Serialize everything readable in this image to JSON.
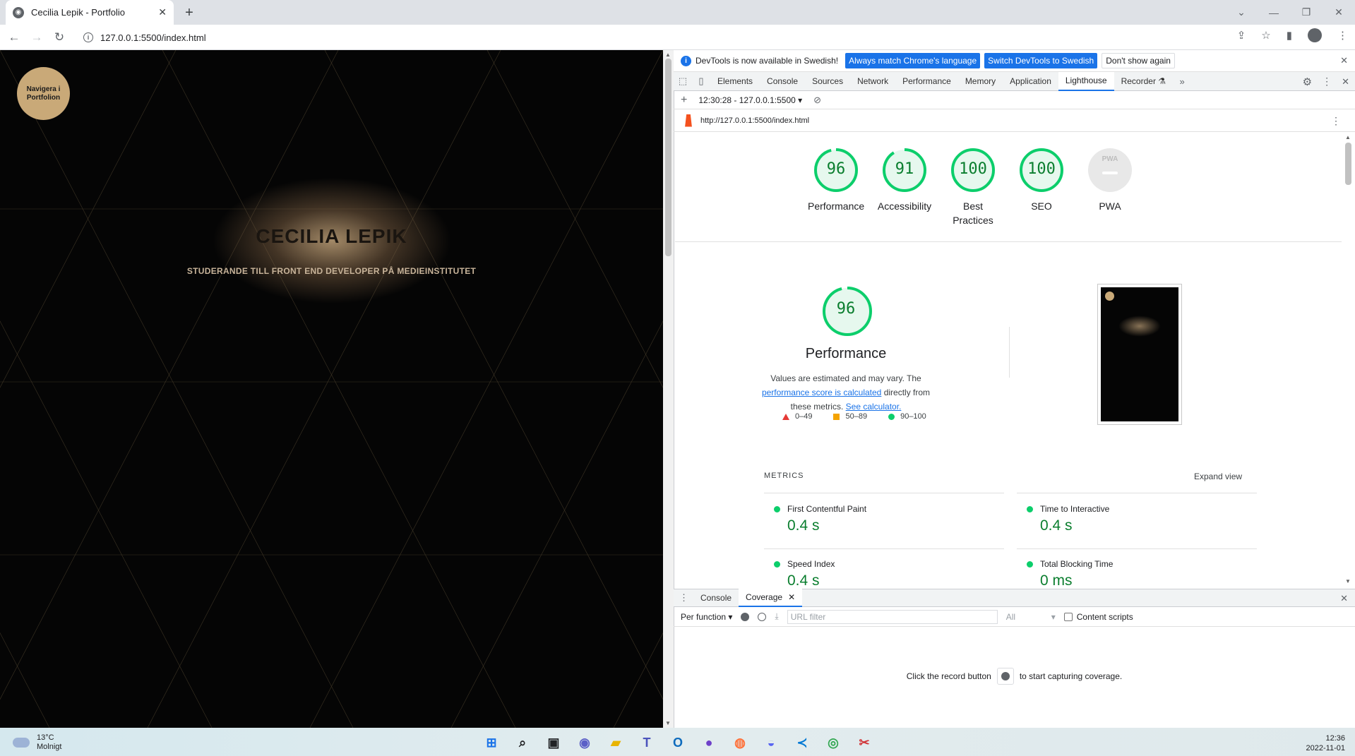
{
  "browser": {
    "tab_title": "Cecilia Lepik - Portfolio",
    "url": "127.0.0.1:5500/index.html"
  },
  "page": {
    "nav_button": "Navigera i Portfolion",
    "hero_title": "CECILIA LEPIK",
    "hero_subtitle": "STUDERANDE TILL FRONT END DEVELOPER PÅ MEDIEINSTITUTET"
  },
  "devtools": {
    "infobar": {
      "message": "DevTools is now available in Swedish!",
      "btn_match": "Always match Chrome's language",
      "btn_switch": "Switch DevTools to Swedish",
      "btn_dont": "Don't show again"
    },
    "tabs": [
      "Elements",
      "Console",
      "Sources",
      "Network",
      "Performance",
      "Memory",
      "Application",
      "Lighthouse",
      "Recorder"
    ],
    "active_tab": "Lighthouse",
    "lighthouse_report_select": "12:30:28 - 127.0.0.1:5500",
    "report_url": "http://127.0.0.1:5500/index.html",
    "scores": [
      {
        "label": "Performance",
        "value": "96",
        "score": 96
      },
      {
        "label": "Accessibility",
        "value": "91",
        "score": 91
      },
      {
        "label": "Best Practices",
        "value": "100",
        "score": 100
      },
      {
        "label": "SEO",
        "value": "100",
        "score": 100
      },
      {
        "label": "PWA",
        "value": "PWA",
        "score": null
      }
    ],
    "perf": {
      "score": "96",
      "title": "Performance",
      "desc_1": "Values are estimated and may vary. The",
      "link_1": "performance score is calculated",
      "desc_2": "directly from these metrics.",
      "link_2": "See calculator.",
      "legend": [
        "0–49",
        "50–89",
        "90–100"
      ]
    },
    "metrics": {
      "heading": "METRICS",
      "expand": "Expand view",
      "items": [
        {
          "name": "First Contentful Paint",
          "value": "0.4 s"
        },
        {
          "name": "Time to Interactive",
          "value": "0.4 s"
        },
        {
          "name": "Speed Index",
          "value": "0.4 s"
        },
        {
          "name": "Total Blocking Time",
          "value": "0 ms"
        }
      ]
    },
    "drawer": {
      "tabs": [
        "Console",
        "Coverage"
      ],
      "per_function": "Per function",
      "url_filter": "URL filter",
      "type_select": "All",
      "content_scripts": "Content scripts",
      "msg_1": "Click the record button",
      "msg_2": "to start capturing coverage."
    }
  },
  "taskbar": {
    "temp": "13°C",
    "weather": "Molnigt",
    "time": "12:36",
    "date": "2022-11-01"
  },
  "colors": {
    "pass_green": "#0cce6b",
    "score_text": "#0a7e2e",
    "accent_blue": "#1a73e8",
    "gold": "#c9a978"
  }
}
